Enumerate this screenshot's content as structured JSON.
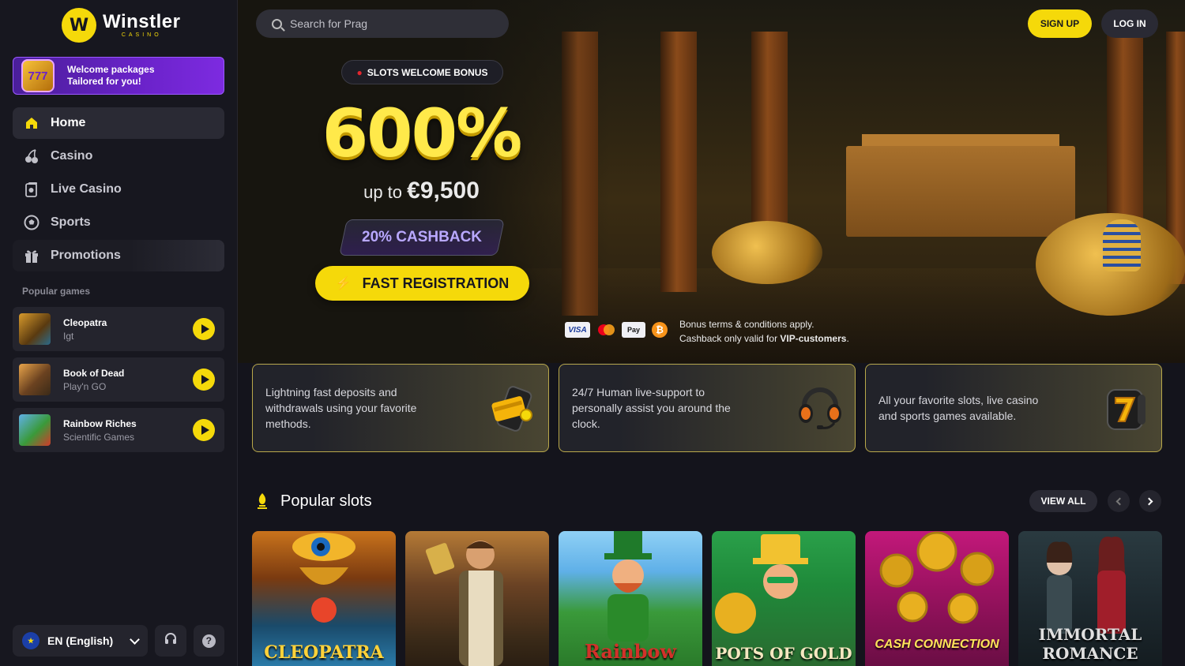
{
  "brand": {
    "name": "Winstler",
    "sub": "CASINO",
    "mark": "W"
  },
  "welcome": {
    "line1": "Welcome packages",
    "line2": "Tailored for you!",
    "badge": "777"
  },
  "nav": [
    {
      "label": "Home",
      "icon": "home-icon",
      "active": true
    },
    {
      "label": "Casino",
      "icon": "cherry-icon"
    },
    {
      "label": "Live Casino",
      "icon": "live-casino-icon"
    },
    {
      "label": "Sports",
      "icon": "soccer-ball-icon"
    },
    {
      "label": "Promotions",
      "icon": "gift-icon"
    }
  ],
  "popular_games": {
    "title": "Popular games",
    "items": [
      {
        "name": "Cleopatra",
        "provider": "Igt"
      },
      {
        "name": "Book of Dead",
        "provider": "Play'n GO"
      },
      {
        "name": "Rainbow Riches",
        "provider": "Scientific Games"
      }
    ]
  },
  "language": {
    "label": "EN (English)"
  },
  "search": {
    "placeholder": "Search for Prag"
  },
  "auth": {
    "signup": "SIGN UP",
    "login": "LOG IN"
  },
  "hero": {
    "tag": "SLOTS WELCOME BONUS",
    "percent": "600%",
    "upto_prefix": "up to",
    "upto_amount": "€9,500",
    "cashback": "20% CASHBACK",
    "cta": "FAST REGISTRATION",
    "payments": {
      "visa": "VISA",
      "apple": "Pay",
      "btc": "₿"
    },
    "terms_line1": "Bonus terms & conditions apply.",
    "terms_line2_prefix": "Cashback only valid for",
    "terms_line2_bold": "VIP-customers",
    "terms_line2_suffix": "."
  },
  "features": [
    {
      "text": "Lightning fast deposits and withdrawals using your favorite methods.",
      "icon": "wallet-icon"
    },
    {
      "text": "24/7 Human live-support to personally assist you around the clock.",
      "icon": "headset-icon"
    },
    {
      "text": "All your favorite slots, live casino and sports games available.",
      "icon": "slot-seven-icon"
    }
  ],
  "popular_slots": {
    "title": "Popular slots",
    "view_all": "VIEW ALL",
    "items": [
      {
        "name": "CLEOPATRA"
      },
      {
        "name": ""
      },
      {
        "name": "Rainbow"
      },
      {
        "name": "POTS OF GOLD"
      },
      {
        "name": "CASH CONNECTION"
      },
      {
        "name": "IMMORTAL ROMANCE"
      }
    ]
  },
  "colors": {
    "accent": "#f5d90a",
    "sidebar": "#17171f",
    "promo_purple": "#6a22c9"
  }
}
